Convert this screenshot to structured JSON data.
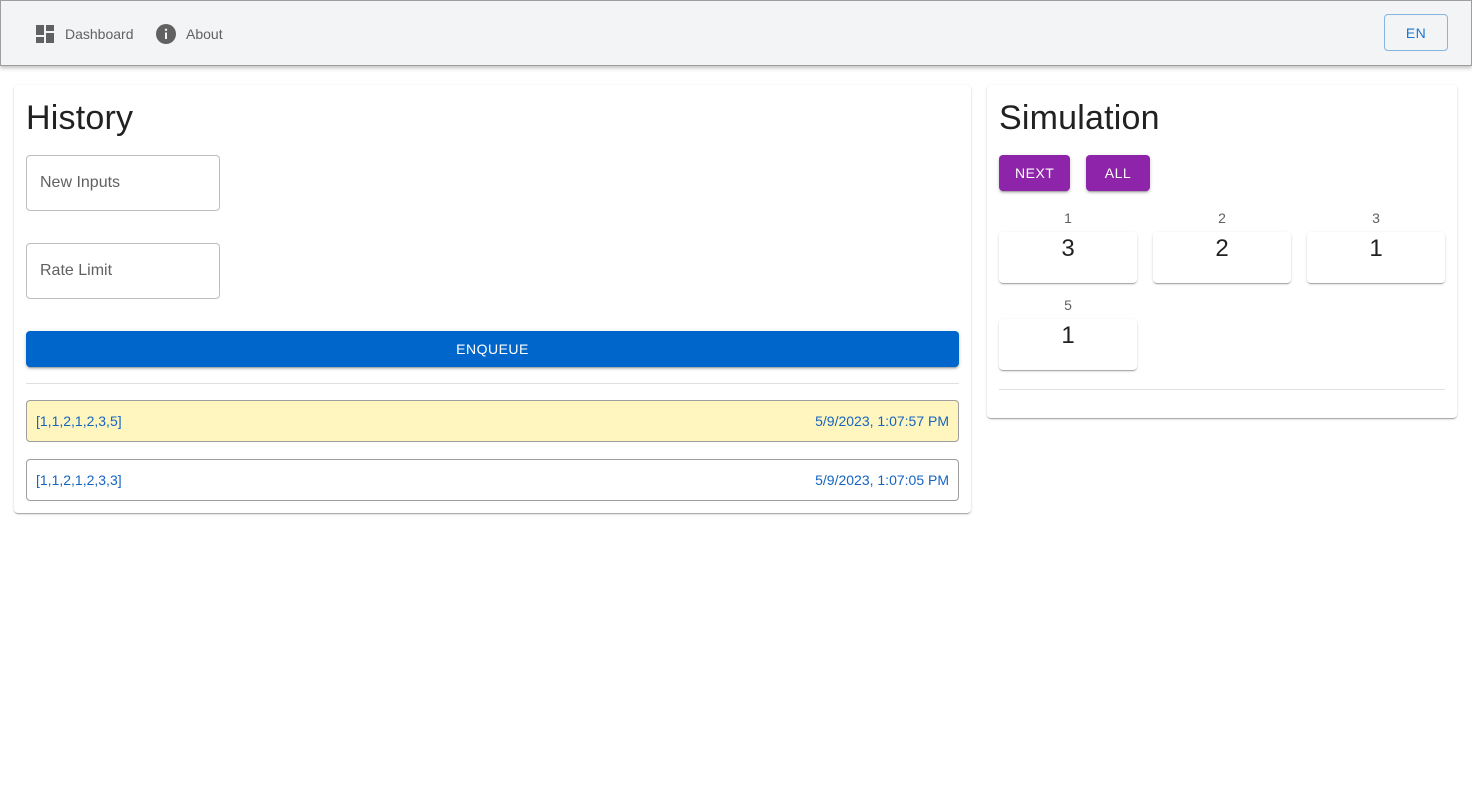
{
  "nav": {
    "dashboard_label": "Dashboard",
    "about_label": "About",
    "dashboard_icon": "dashboard-icon",
    "about_icon": "info-icon",
    "language": "EN"
  },
  "history": {
    "title": "History",
    "new_inputs_placeholder": "New Inputs",
    "rate_limit_placeholder": "Rate Limit",
    "enqueue_label": "ENQUEUE",
    "items": [
      {
        "value": "[1,1,2,1,2,3,5]",
        "timestamp": "5/9/2023, 1:07:57 PM",
        "highlighted": true
      },
      {
        "value": "[1,1,2,1,2,3,3]",
        "timestamp": "5/9/2023, 1:07:05 PM",
        "highlighted": false
      }
    ]
  },
  "simulation": {
    "title": "Simulation",
    "next_label": "NEXT",
    "all_label": "ALL",
    "cells": [
      {
        "label": "1",
        "value": "3"
      },
      {
        "label": "2",
        "value": "2"
      },
      {
        "label": "3",
        "value": "1"
      },
      {
        "label": "5",
        "value": "1"
      }
    ]
  },
  "colors": {
    "primary": "#0066cc",
    "secondary": "#8e24aa",
    "highlight": "#fff5bf",
    "link_text": "#1565c0"
  }
}
